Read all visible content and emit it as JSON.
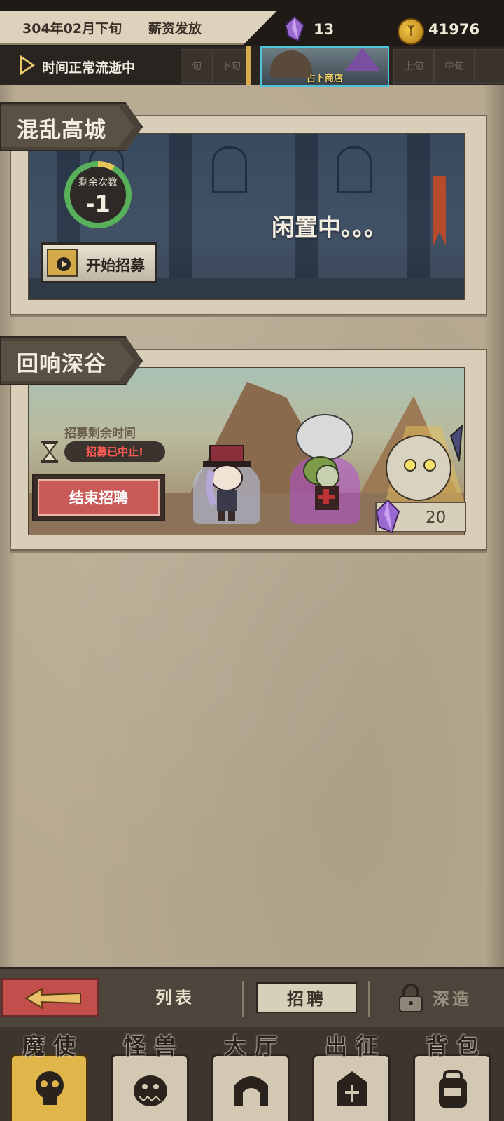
{
  "header": {
    "date": "304年02月下旬",
    "event": "薪资发放",
    "crystals": "13",
    "gold": "41976",
    "coin_symbol": "ᛉ"
  },
  "timeline": {
    "status": "时间正常流逝中",
    "slots_left": [
      "旬",
      "下旬"
    ],
    "shop_label": "占卜商店",
    "slots_right": [
      "上旬",
      "中旬"
    ]
  },
  "panels": [
    {
      "title": "混乱高城",
      "counter_label": "剩余次数",
      "counter_value": "-1",
      "button_label": "开始招募",
      "idle_text": "闲置中。。。"
    },
    {
      "title": "回响深谷",
      "recruit_time_label": "招募剩余时间",
      "status": "招募已中止!",
      "button_label": "结束招聘",
      "price": "20"
    }
  ],
  "subnav": {
    "tabs": [
      {
        "label": "列表"
      },
      {
        "label": "招聘"
      },
      {
        "label": "深造"
      }
    ]
  },
  "mainnav": {
    "items": [
      {
        "label": "魔使",
        "icon": "skull-icon"
      },
      {
        "label": "怪兽",
        "icon": "monster-icon"
      },
      {
        "label": "大厅",
        "icon": "hall-icon"
      },
      {
        "label": "出征",
        "icon": "battle-icon"
      },
      {
        "label": "背包",
        "icon": "backpack-icon"
      }
    ]
  },
  "colors": {
    "accent_red": "#c95a58",
    "status_red": "#ff5b55",
    "shop_border": "#4fc3d9",
    "gold": "#e0b64a"
  }
}
